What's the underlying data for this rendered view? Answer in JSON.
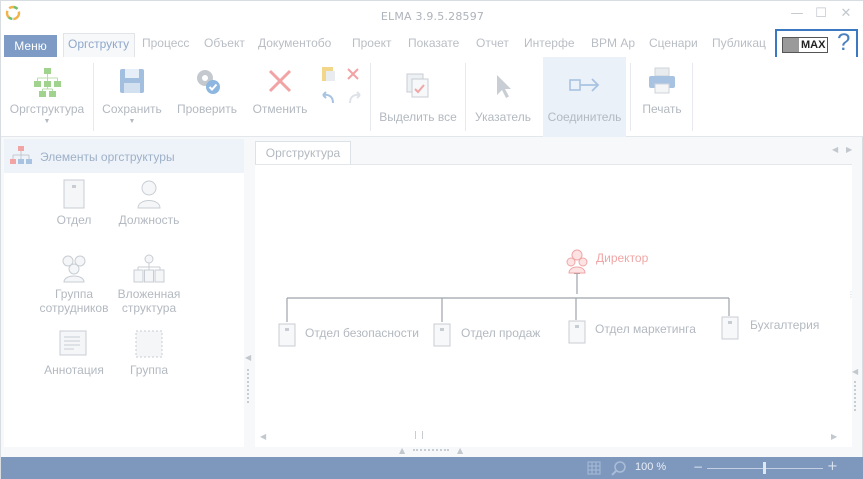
{
  "window": {
    "title": "ELMA 3.9.5.28597"
  },
  "tabs": {
    "menu_label": "Меню",
    "items": [
      {
        "label": "Оргструкту",
        "active": true
      },
      {
        "label": "Процесс",
        "active": false
      },
      {
        "label": "Объект",
        "active": false
      },
      {
        "label": "Документобо",
        "active": false
      },
      {
        "label": "Проект",
        "active": false
      },
      {
        "label": "Показате",
        "active": false
      },
      {
        "label": "Отчет",
        "active": false
      },
      {
        "label": "Интерфе",
        "active": false
      },
      {
        "label": "BPM Ар",
        "active": false
      },
      {
        "label": "Сценари",
        "active": false
      },
      {
        "label": "Публикац",
        "active": false
      }
    ],
    "max_label": "MAX",
    "help_label": "?"
  },
  "ribbon": {
    "orgstructure": "Оргструктура",
    "save": "Сохранить",
    "check": "Проверить",
    "cancel": "Отменить",
    "select_all": "Выделить все",
    "pointer": "Указатель",
    "connector": "Соединитель",
    "print": "Печать"
  },
  "left_panel": {
    "title": "Элементы оргструктуры",
    "items": {
      "department": "Отдел",
      "position": "Должность",
      "group_line1": "Группа",
      "group_line2": "сотрудников",
      "nested_line1": "Вложенная",
      "nested_line2": "структура",
      "annotation": "Аннотация",
      "group": "Группа"
    }
  },
  "canvas": {
    "tab_label": "Оргструктура",
    "director": "Директор",
    "departments": [
      "Отдел безопасности",
      "Отдел продаж",
      "Отдел маркетинга",
      "Бухгалтерия"
    ]
  },
  "status": {
    "zoom": "100 %"
  },
  "colors": {
    "menu_bg": "#7d9bc4",
    "statusbar_bg": "#7e97bd",
    "director": "#f0a6a6",
    "highlight_box": "#3a78c2"
  }
}
